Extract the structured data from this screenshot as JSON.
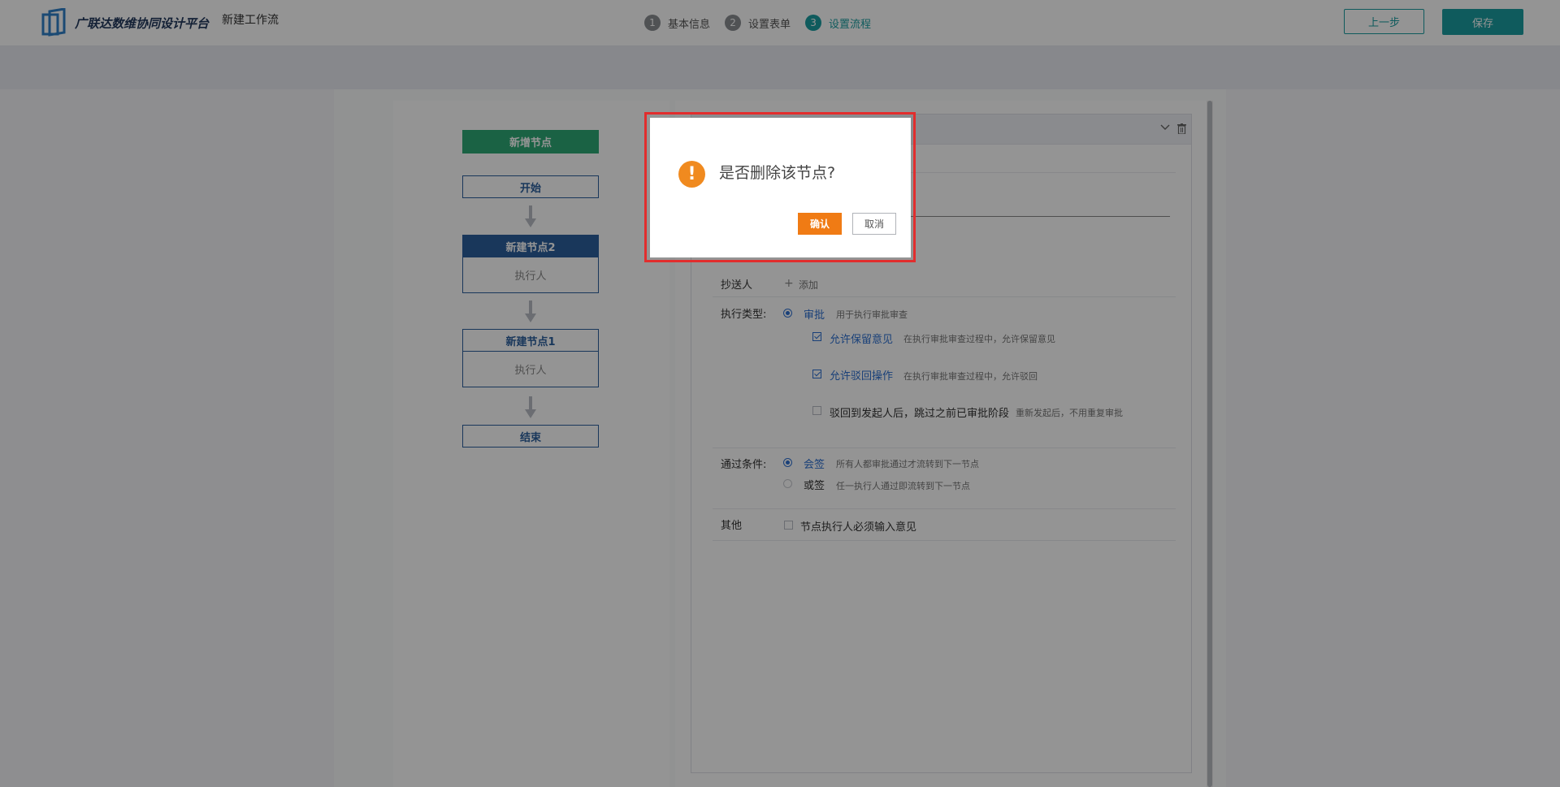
{
  "header": {
    "brand": "广联达数维协同设计平台",
    "title": "新建工作流",
    "steps": [
      {
        "num": "1",
        "label": "基本信息",
        "active": false
      },
      {
        "num": "2",
        "label": "设置表单",
        "active": false
      },
      {
        "num": "3",
        "label": "设置流程",
        "active": true
      }
    ],
    "prev_label": "上一步",
    "save_label": "保存"
  },
  "flow": {
    "add_node_label": "新增节点",
    "start_label": "开始",
    "end_label": "结束",
    "nodes": [
      {
        "title": "新建节点2",
        "body": "执行人",
        "selected": true
      },
      {
        "title": "新建节点1",
        "body": "执行人",
        "selected": false
      }
    ]
  },
  "config": {
    "cc_label": "抄送人",
    "cc_add": "添加",
    "exec_type_label": "执行类型:",
    "exec_type_option": "审批",
    "exec_type_hint": "用于执行审批审查",
    "options": [
      {
        "label": "允许保留意见",
        "hint": "在执行审批审查过程中，允许保留意见",
        "checked": true
      },
      {
        "label": "允许驳回操作",
        "hint": "在执行审批审查过程中，允许驳回",
        "checked": true
      },
      {
        "label": "驳回到发起人后，跳过之前已审批阶段",
        "hint": "重新发起后，不用重复审批",
        "checked": false
      }
    ],
    "pass_label": "通过条件:",
    "pass_options": [
      {
        "label": "会签",
        "hint": "所有人都审批通过才流转到下一节点",
        "selected": true
      },
      {
        "label": "或签",
        "hint": "任一执行人通过即流转到下一节点",
        "selected": false
      }
    ],
    "other_label": "其他",
    "other_option": "节点执行人必须输入意见"
  },
  "dialog": {
    "icon": "!",
    "message": "是否删除该节点?",
    "confirm_label": "确认",
    "cancel_label": "取消"
  },
  "colors": {
    "teal": "#1a9da0",
    "node_blue": "#2c5f9e",
    "add_green": "#2eaa75",
    "warn_orange": "#f08a1f",
    "highlight_red": "#e22d2d"
  }
}
